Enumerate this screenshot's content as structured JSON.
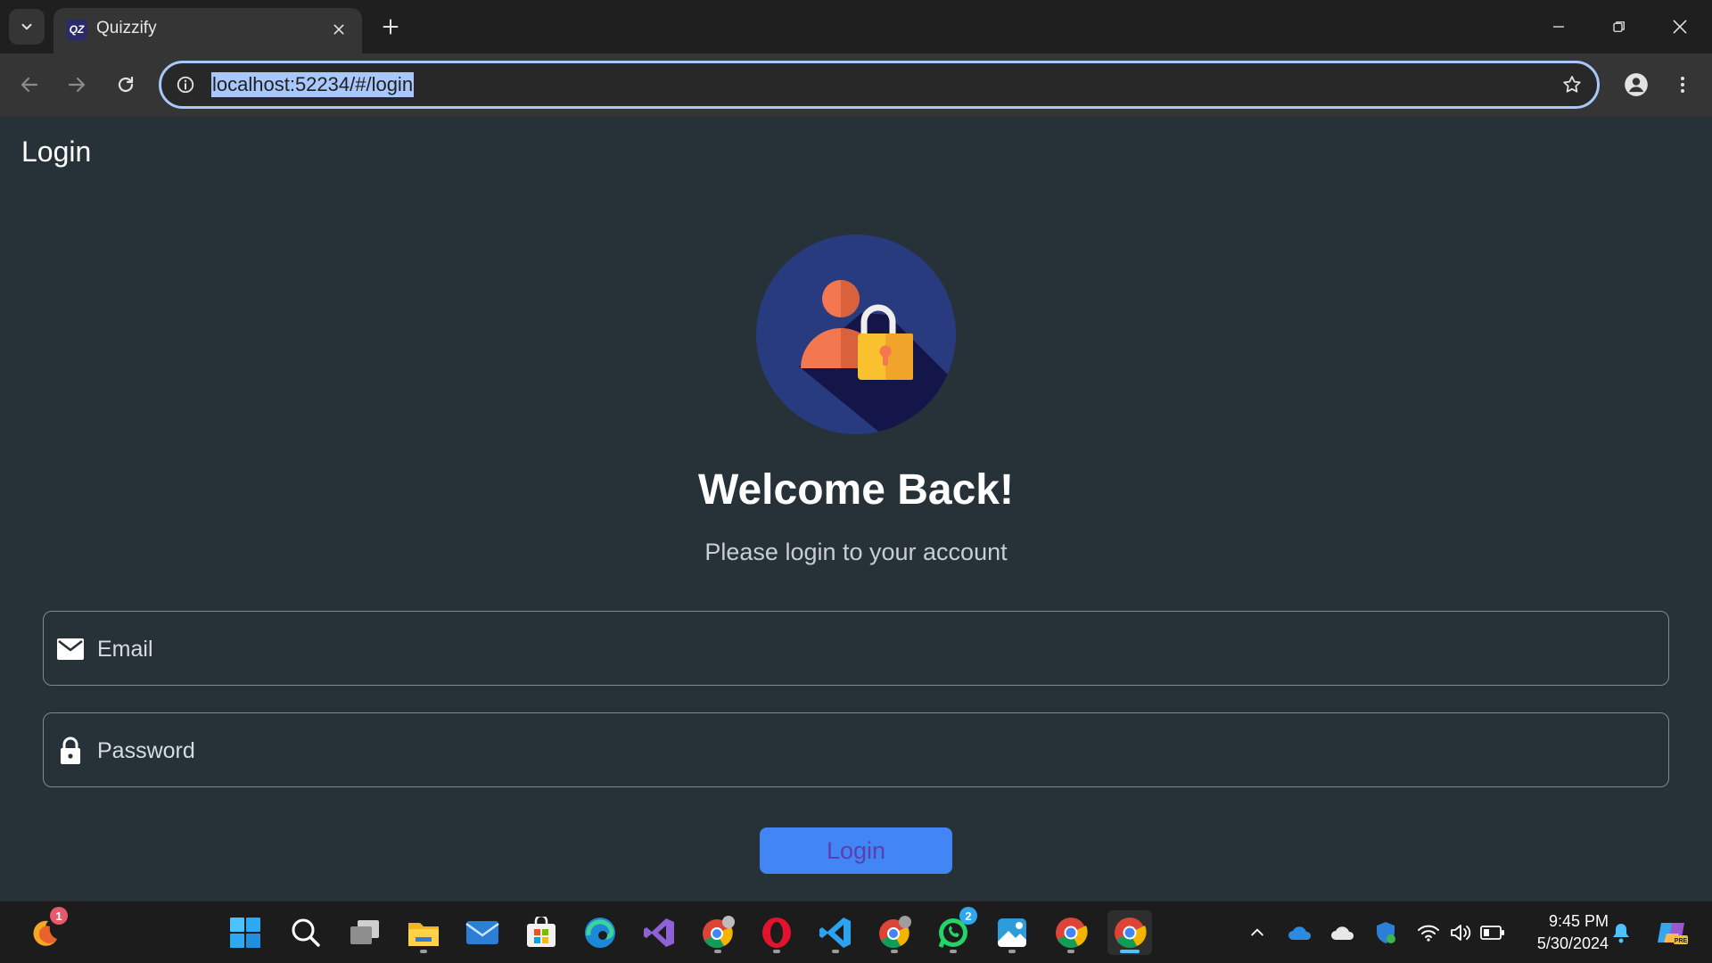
{
  "browser": {
    "tab_title": "Quizzify",
    "tab_favicon_text": "QZ",
    "url": "localhost:52234/#/login"
  },
  "app": {
    "appbar_title": "Login",
    "welcome_heading": "Welcome Back!",
    "subtitle": "Please login to your account",
    "email_label": "Email",
    "password_label": "Password",
    "login_button": "Login",
    "colors": {
      "background": "#263238",
      "button": "#4285f4",
      "button_text": "#5b3fb0",
      "avatar_circle": "#283b7e"
    }
  },
  "taskbar": {
    "icons": [
      "weather-app-icon",
      "windows-start-icon",
      "search-icon",
      "task-view-icon",
      "file-explorer-icon",
      "mail-icon",
      "microsoft-store-icon",
      "edge-icon",
      "visual-studio-icon",
      "chrome-profile-icon",
      "opera-icon",
      "vscode-icon",
      "chrome-profile-icon",
      "whatsapp-icon",
      "photos-icon",
      "chrome-icon",
      "chrome-active-icon"
    ],
    "weather_badge": "1",
    "whatsapp_badge": "2",
    "time": "9:45 PM",
    "date": "5/30/2024"
  }
}
